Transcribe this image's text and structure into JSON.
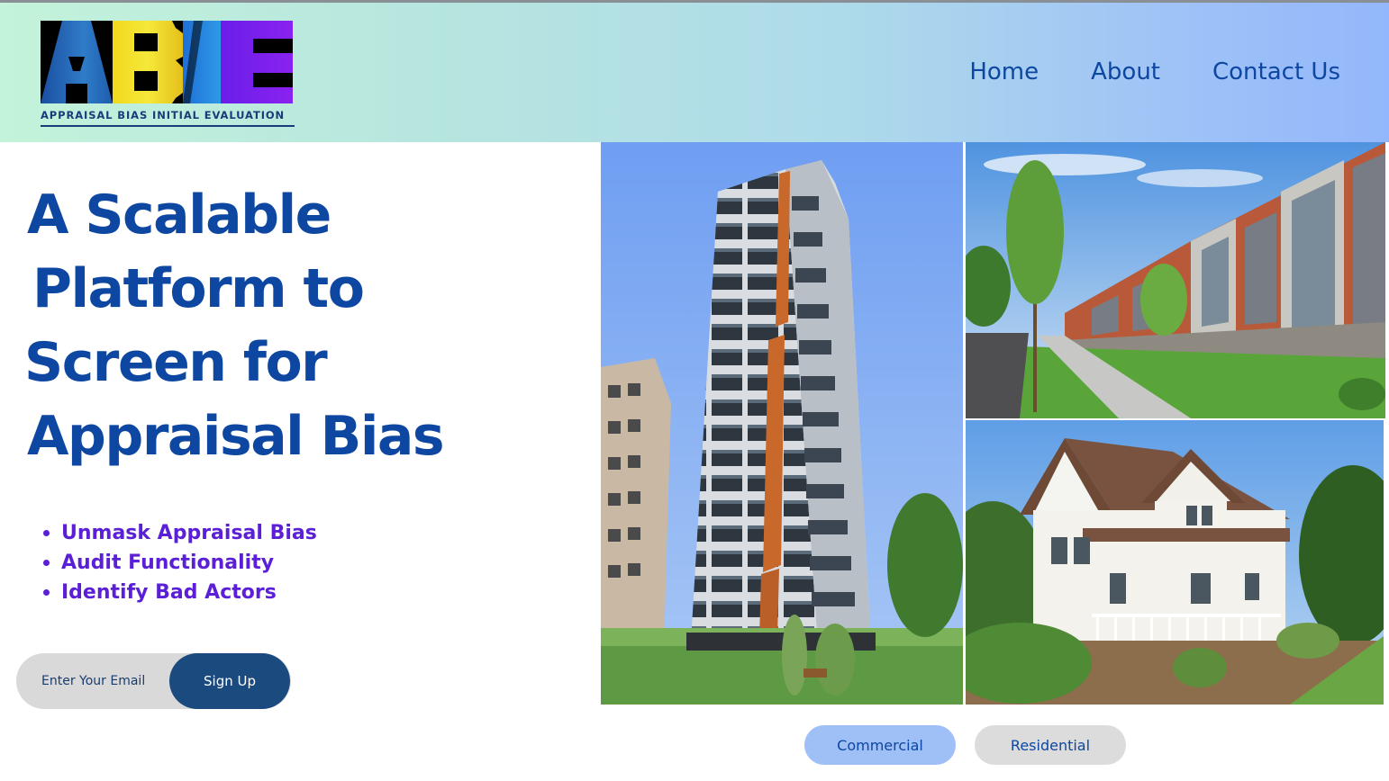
{
  "header": {
    "logo": {
      "letters": "ABIE",
      "caption": "APPRAISAL BIAS INITIAL EVALUATION",
      "colors": [
        "#2f7cc8",
        "#f6e83a",
        "#2f9ae6",
        "#8a22f0"
      ]
    },
    "nav": [
      {
        "label": "Home"
      },
      {
        "label": "About"
      },
      {
        "label": "Contact Us"
      }
    ]
  },
  "hero": {
    "title_lines": [
      "A Scalable",
      "Platform to",
      "Screen for",
      "Appraisal Bias"
    ],
    "features": [
      "Unmask Appraisal Bias",
      "Audit Functionality",
      "Identify Bad Actors"
    ],
    "signup": {
      "email_placeholder": "Enter Your Email",
      "button_label": "Sign Up"
    }
  },
  "gallery": {
    "images": [
      "high-rise-apartment-tower",
      "brick-townhouses-row",
      "white-victorian-house"
    ],
    "category_buttons": [
      {
        "label": "Commercial",
        "active": true
      },
      {
        "label": "Residential",
        "active": false
      }
    ]
  },
  "colors": {
    "primary": "#0d47a1",
    "accent_purple": "#5a1fd6",
    "signup_button": "#1a4a7e",
    "header_gradient_start": "#c3f3da",
    "header_gradient_end": "#93b7fb"
  }
}
